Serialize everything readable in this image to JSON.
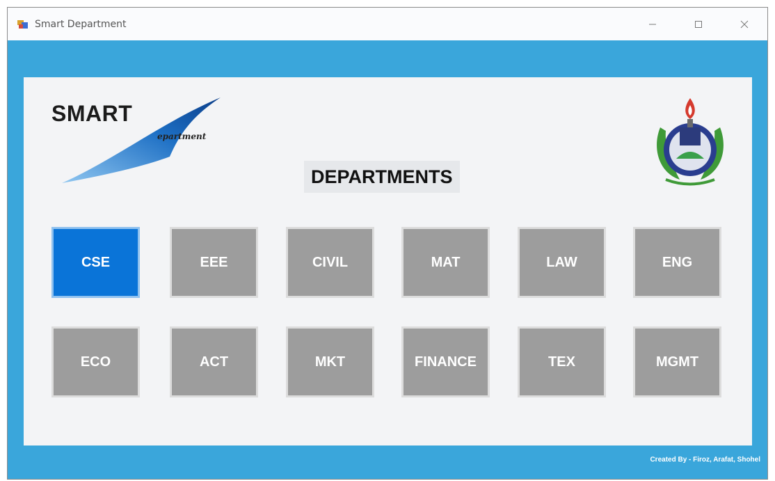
{
  "window": {
    "title": "Smart Department",
    "controls": {
      "minimize_icon": "minimize-icon",
      "maximize_icon": "maximize-icon",
      "close_icon": "close-icon"
    }
  },
  "logo": {
    "word": "SMART",
    "sub": "epartment"
  },
  "heading": "DEPARTMENTS",
  "departments_row1": [
    {
      "label": "CSE",
      "active": true
    },
    {
      "label": "EEE",
      "active": false
    },
    {
      "label": "CIVIL",
      "active": false
    },
    {
      "label": "MAT",
      "active": false
    },
    {
      "label": "LAW",
      "active": false
    },
    {
      "label": "ENG",
      "active": false
    }
  ],
  "departments_row2": [
    {
      "label": "ECO",
      "active": false
    },
    {
      "label": "ACT",
      "active": false
    },
    {
      "label": "MKT",
      "active": false
    },
    {
      "label": "FINANCE",
      "active": false
    },
    {
      "label": "TEX",
      "active": false
    },
    {
      "label": "MGMT",
      "active": false
    }
  ],
  "footer": {
    "credit": "Created By - Firoz, Arafat, Shohel"
  },
  "colors": {
    "frame": "#3aa6db",
    "panel": "#f3f4f6",
    "button": "#9d9d9d",
    "button_active": "#0a74d8"
  }
}
